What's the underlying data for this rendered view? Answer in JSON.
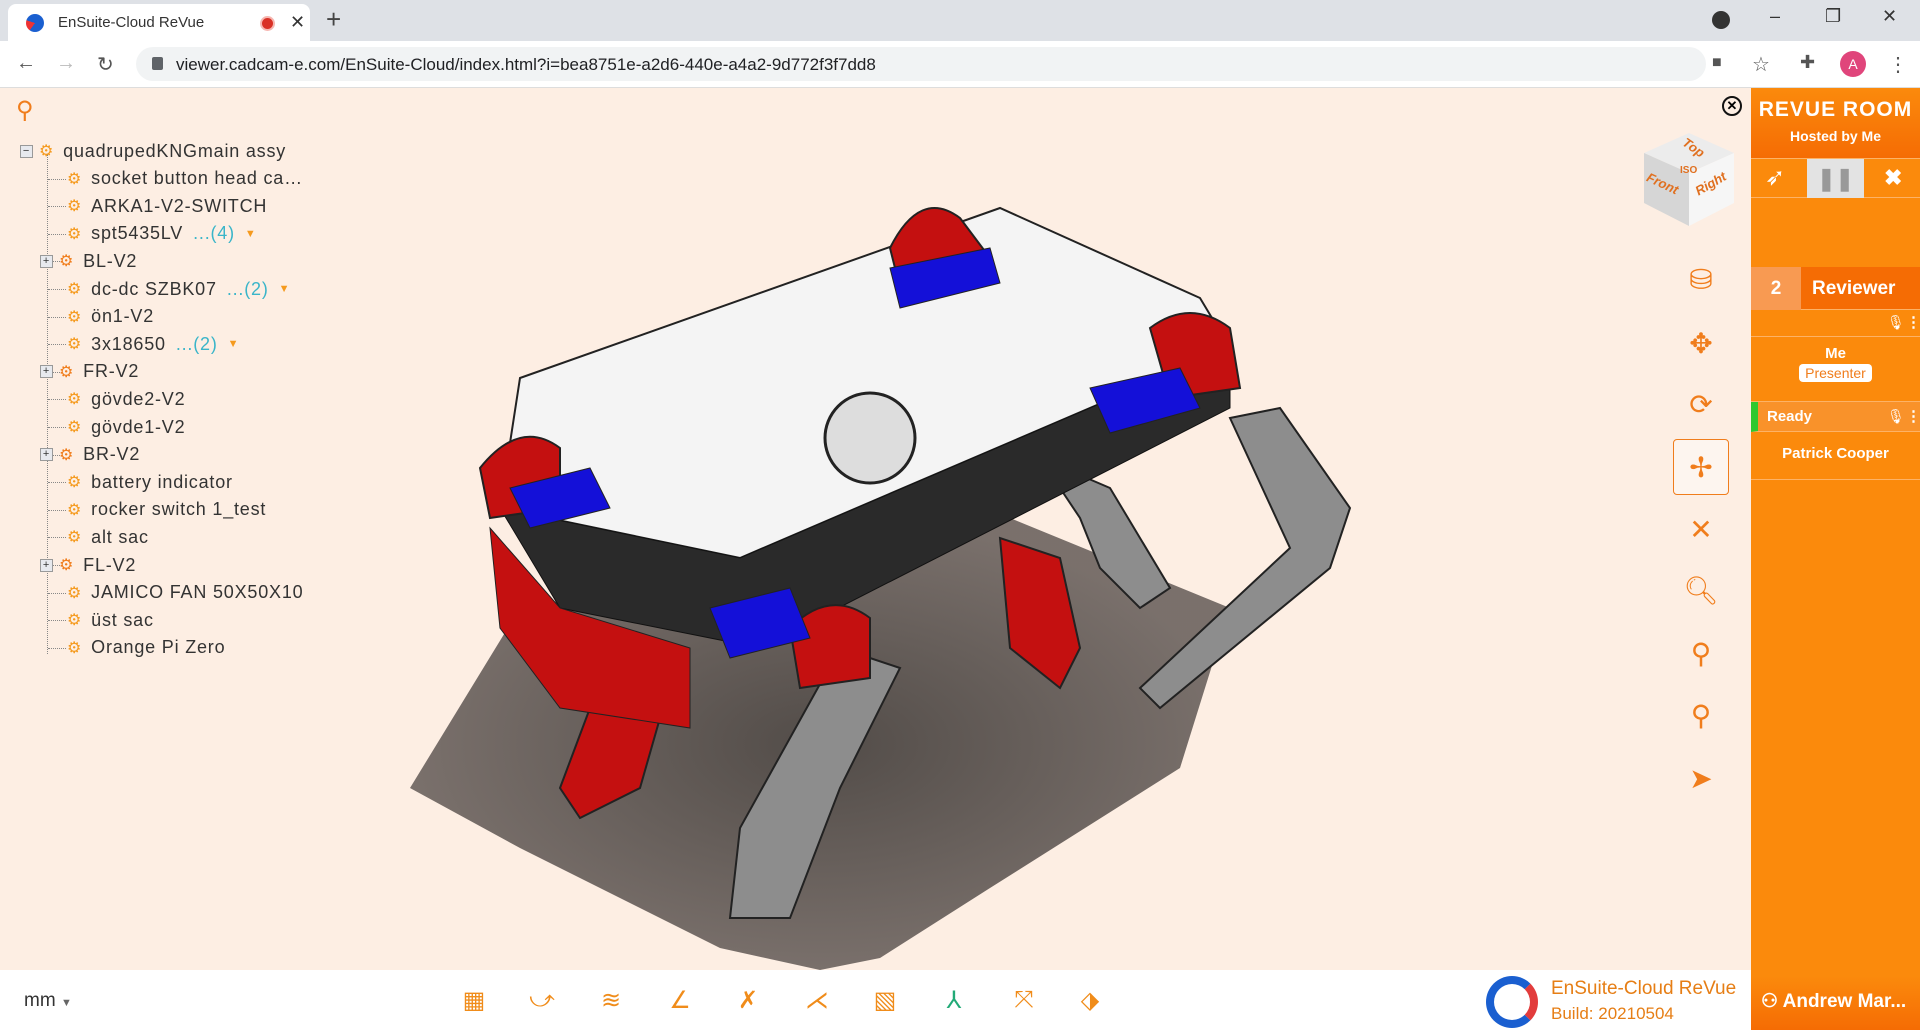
{
  "browser": {
    "tab_title": "EnSuite-Cloud ReVue",
    "url": "viewer.cadcam-e.com/EnSuite-Cloud/index.html?i=bea8751e-a2d6-440e-a4a2-9d772f3f7dd8",
    "profile_initial": "A"
  },
  "tree": {
    "root": "quadrupedKNGmain assy",
    "items": [
      {
        "label": "socket button head ca…",
        "type": "part"
      },
      {
        "label": "ARKA1-V2-SWITCH",
        "type": "part"
      },
      {
        "label": "spt5435LV",
        "type": "part",
        "count": "...(4)"
      },
      {
        "label": "BL-V2",
        "type": "assembly"
      },
      {
        "label": "dc-dc SZBK07",
        "type": "part",
        "count": "...(2)"
      },
      {
        "label": "ön1-V2",
        "type": "part"
      },
      {
        "label": "3x18650",
        "type": "part",
        "count": "...(2)"
      },
      {
        "label": "FR-V2",
        "type": "assembly"
      },
      {
        "label": "gövde2-V2",
        "type": "part"
      },
      {
        "label": "gövde1-V2",
        "type": "part"
      },
      {
        "label": "BR-V2",
        "type": "assembly"
      },
      {
        "label": "battery indicator",
        "type": "part"
      },
      {
        "label": "rocker switch 1_test",
        "type": "part"
      },
      {
        "label": "alt sac",
        "type": "part"
      },
      {
        "label": "FL-V2",
        "type": "assembly"
      },
      {
        "label": "JAMICO FAN 50X50X10",
        "type": "part"
      },
      {
        "label": "üst sac",
        "type": "part"
      },
      {
        "label": "Orange Pi Zero",
        "type": "part"
      }
    ]
  },
  "navcube": {
    "top": "Top",
    "front": "Front",
    "right": "Right",
    "iso": "ISO"
  },
  "view_tools": [
    "cylinder-icon",
    "pan-icon",
    "rotate-icon",
    "orbit-icon",
    "close-icon",
    "zoom-fit-icon",
    "zoom-window-icon",
    "zoom-selection-icon",
    "select-pointer-icon"
  ],
  "bottom": {
    "units": "mm",
    "tools": [
      "section-view-icon",
      "measure-arc-icon",
      "measure-surface-icon",
      "measure-angle-icon",
      "measure-distance-icon",
      "measure-point-icon",
      "hatch-icon",
      "axis-triad-icon",
      "explode-icon",
      "reset-icon"
    ],
    "brand": "EnSuite-Cloud ReVue",
    "build": "Build: 20210504"
  },
  "room": {
    "title": "REVUE ROOM",
    "host": "Hosted by Me",
    "reviewer_count": "2",
    "reviewer_label": "Reviewer",
    "me": "Me",
    "presenter": "Presenter",
    "status": "Ready",
    "participant": "Patrick Cooper",
    "user": "Andrew Mar..."
  },
  "colors": {
    "accent": "#fb8a0c",
    "status_ready": "#2ec82e",
    "count": "#3ab5c9"
  }
}
